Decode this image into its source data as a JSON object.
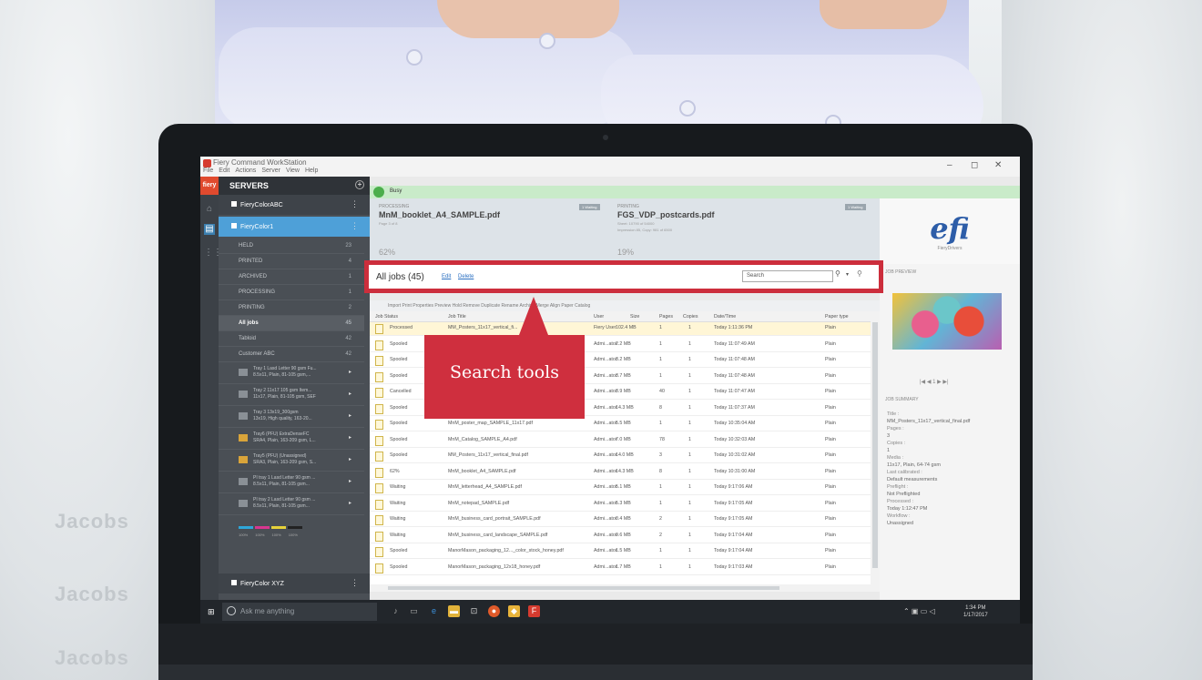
{
  "app": {
    "title": "Fiery Command WorkStation",
    "menu": [
      "File",
      "Edit",
      "Actions",
      "Server",
      "View",
      "Help"
    ],
    "win_min": "–",
    "win_max": "◻",
    "win_close": "✕"
  },
  "sidebar": {
    "logo": "fiery",
    "header": "SERVERS",
    "servers": [
      {
        "name": "FieryColorABC"
      },
      {
        "name": "FieryColor1"
      },
      {
        "name": "FieryColor XYZ"
      }
    ],
    "queues": [
      {
        "label": "HELD",
        "count": "23"
      },
      {
        "label": "PRINTED",
        "count": "4"
      },
      {
        "label": "ARCHIVED",
        "count": "1"
      },
      {
        "label": "PROCESSING",
        "count": "1"
      },
      {
        "label": "PRINTING",
        "count": "2"
      },
      {
        "label": "All jobs",
        "count": "45"
      },
      {
        "label": "Tabloid",
        "count": "42"
      },
      {
        "label": "Customer ABC",
        "count": "42"
      }
    ],
    "trays": [
      {
        "l1": "Tray 1 Lasd Letter 90 gsm Fu...",
        "l2": "8.5x11, Plain, 81-105 gsm,..."
      },
      {
        "l1": "Tray 2 11x17 105 gsm Item...",
        "l2": "11x17, Plain, 81-105 gsm, SEF"
      },
      {
        "l1": "Tray 3 13x19_300gsm",
        "l2": "13x19, High quality, 163-20..."
      },
      {
        "l1": "Tray6 (PFU) ExtraDenseFC",
        "l2": "SRA4, Plain, 163-209 gsm, L..."
      },
      {
        "l1": "Tray5 (PFU) (Unassigned)",
        "l2": "SRA3, Plain, 163-209 gsm, S..."
      },
      {
        "l1": "PI tray 1 Lasd Letter 90 gsm ...",
        "l2": "8.5x11, Plain, 81-105 gsm..."
      },
      {
        "l1": "PI tray 2 Lasd Letter 90 gsm ...",
        "l2": "8.5x11, Plain, 81-105 gsm..."
      }
    ],
    "ink_pct": [
      "100%",
      "100%",
      "100%",
      "100%"
    ]
  },
  "status": {
    "text": "Busy"
  },
  "processing": {
    "label": "PROCESSING",
    "file": "MnM_booklet_A4_SAMPLE.pdf",
    "sub": "Page 3 of 8",
    "pct": "62%",
    "badge": "1 Waiting"
  },
  "printing": {
    "label": "PRINTING",
    "file": "FGS_VDP_postcards.pdf",
    "sub1": "Sheet: 10790 of 54000",
    "sub2": "Impression 85, Copy: 981 of 6500",
    "pct": "19%",
    "badge": "1 Waiting"
  },
  "brand": {
    "logo": "efi",
    "sub": "FieryDrivers"
  },
  "search_bar": {
    "title": "All jobs (45)",
    "edit": "Edit",
    "delete": "Delete",
    "placeholder": "Search",
    "search_icon": "magnifier-icon",
    "dropdown_icon": "▾",
    "filter_icon": "⚲"
  },
  "toolbar": {
    "text": "Import   Print   Properties   Preview   Hold   Remove   Duplicate   Rename   Archive   Merge   Align   Paper Catalog"
  },
  "table": {
    "headers": [
      "Job Status",
      "Job Title",
      "User",
      "Size",
      "Pages",
      "Copies",
      "Date/Time",
      "Paper type"
    ],
    "rows": [
      {
        "status": "Processed",
        "title": "MM_Posters_11x17_vertical_fi...",
        "user": "Fiery User",
        "size": "102.4 MB",
        "pages": "1",
        "copies": "1",
        "time": "Today 1:11:36 PM",
        "paper": "Plain"
      },
      {
        "status": "Spooled",
        "title": "",
        "user": "Admi...ator",
        "size": "2.2 MB",
        "pages": "1",
        "copies": "1",
        "time": "Today 11:07:49 AM",
        "paper": "Plain"
      },
      {
        "status": "Spooled",
        "title": "",
        "user": "Admi...ator",
        "size": "3.2 MB",
        "pages": "1",
        "copies": "1",
        "time": "Today 11:07:48 AM",
        "paper": "Plain"
      },
      {
        "status": "Spooled",
        "title": "",
        "user": "Admi...ator",
        "size": "3.7 MB",
        "pages": "1",
        "copies": "1",
        "time": "Today 11:07:48 AM",
        "paper": "Plain"
      },
      {
        "status": "Cancelled",
        "title": "",
        "user": "Admi...ator",
        "size": "3.9 MB",
        "pages": "40",
        "copies": "1",
        "time": "Today 11:07:47 AM",
        "paper": "Plain"
      },
      {
        "status": "Spooled",
        "title": "",
        "user": "Admi...ator",
        "size": "14.3 MB",
        "pages": "8",
        "copies": "1",
        "time": "Today 11:07:37 AM",
        "paper": "Plain"
      },
      {
        "status": "Spooled",
        "title": "MnM_poster_map_SAMPLE_11x17.pdf",
        "user": "Admi...ator",
        "size": "5.5 MB",
        "pages": "1",
        "copies": "1",
        "time": "Today 10:35:04 AM",
        "paper": "Plain"
      },
      {
        "status": "Spooled",
        "title": "MnM_Catalog_SAMPLE_A4.pdf",
        "user": "Admi...ator",
        "size": "7.0 MB",
        "pages": "78",
        "copies": "1",
        "time": "Today 10:32:03 AM",
        "paper": "Plain"
      },
      {
        "status": "Spooled",
        "title": "MM_Posters_11x17_vertical_final.pdf",
        "user": "Admi...ator",
        "size": "14.0 MB",
        "pages": "3",
        "copies": "1",
        "time": "Today 10:31:02 AM",
        "paper": "Plain"
      },
      {
        "status": "62%",
        "title": "MnM_booklet_A4_SAMPLE.pdf",
        "user": "Admi...ator",
        "size": "14.3 MB",
        "pages": "8",
        "copies": "1",
        "time": "Today 10:31:00 AM",
        "paper": "Plain"
      },
      {
        "status": "Waiting",
        "title": "MnM_letterhead_A4_SAMPLE.pdf",
        "user": "Admi...ator",
        "size": "5.1 MB",
        "pages": "1",
        "copies": "1",
        "time": "Today 9:17:06 AM",
        "paper": "Plain"
      },
      {
        "status": "Waiting",
        "title": "MnM_notepad_SAMPLE.pdf",
        "user": "Admi...ator",
        "size": "5.3 MB",
        "pages": "1",
        "copies": "1",
        "time": "Today 9:17:05 AM",
        "paper": "Plain"
      },
      {
        "status": "Waiting",
        "title": "MnM_business_card_portrait_SAMPLE.pdf",
        "user": "Admi...ator",
        "size": "0.4 MB",
        "pages": "2",
        "copies": "1",
        "time": "Today 9:17:05 AM",
        "paper": "Plain"
      },
      {
        "status": "Waiting",
        "title": "MnM_business_card_landscape_SAMPLE.pdf",
        "user": "Admi...ator",
        "size": "9.6 MB",
        "pages": "2",
        "copies": "1",
        "time": "Today 9:17:04 AM",
        "paper": "Plain"
      },
      {
        "status": "Spooled",
        "title": "ManorMason_packaging_12..._color_stock_honey.pdf",
        "user": "Admi...ator",
        "size": "1.5 MB",
        "pages": "1",
        "copies": "1",
        "time": "Today 9:17:04 AM",
        "paper": "Plain"
      },
      {
        "status": "Spooled",
        "title": "ManorMason_packaging_12x18_honey.pdf",
        "user": "Admi...ator",
        "size": "1.7 MB",
        "pages": "1",
        "copies": "1",
        "time": "Today 9:17:03 AM",
        "paper": "Plain"
      }
    ]
  },
  "right_panel": {
    "preview_header": "JOB PREVIEW",
    "pager": "|◀  ◀   1   ▶  ▶|",
    "summary_header": "JOB SUMMARY",
    "summary": [
      {
        "k": "Title :",
        "v": "MM_Posters_11x17_vertical_final.pdf"
      },
      {
        "k": "Pages :",
        "v": "3"
      },
      {
        "k": "Copies :",
        "v": "1"
      },
      {
        "k": "Media :",
        "v": "11x17, Plain, 64-74 gsm"
      },
      {
        "k": "Last calibrated :",
        "v": "Default measurements"
      },
      {
        "k": "Preflight :",
        "v": "Not Preflighted"
      },
      {
        "k": "Processed :",
        "v": "Today 1:12:47 PM"
      },
      {
        "k": "Workflow :",
        "v": "Unassigned"
      }
    ]
  },
  "callout": {
    "text": "Search tools",
    "color": "#cf2f3e"
  },
  "taskbar": {
    "search": "Ask me anything",
    "time": "1:34 PM",
    "date": "1/17/2017"
  },
  "background_text": [
    "Jacobs",
    "Jacobs",
    "Jacobs"
  ]
}
